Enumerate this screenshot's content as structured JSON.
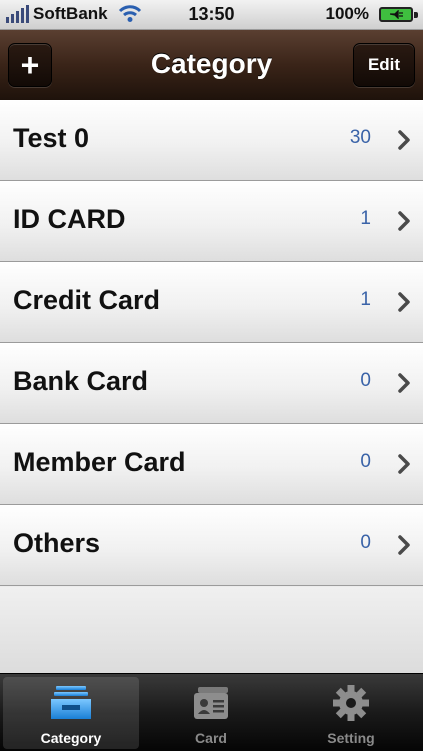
{
  "status_bar": {
    "carrier": "SoftBank",
    "time": "13:50",
    "battery": "100%"
  },
  "nav": {
    "title": "Category",
    "add_label": "+",
    "edit_label": "Edit"
  },
  "categories": [
    {
      "label": "Test 0",
      "count": "30"
    },
    {
      "label": "ID CARD",
      "count": "1"
    },
    {
      "label": "Credit Card",
      "count": "1"
    },
    {
      "label": "Bank Card",
      "count": "0"
    },
    {
      "label": "Member Card",
      "count": "0"
    },
    {
      "label": "Others",
      "count": "0"
    }
  ],
  "tabs": [
    {
      "label": "Category",
      "icon": "tray-icon",
      "active": true
    },
    {
      "label": "Card",
      "icon": "id-card-icon",
      "active": false
    },
    {
      "label": "Setting",
      "icon": "gear-icon",
      "active": false
    }
  ],
  "colors": {
    "accent_count": "#3a63a8",
    "nav_brown": "#3a2418",
    "tab_active_icon": "#2f9fe8"
  }
}
